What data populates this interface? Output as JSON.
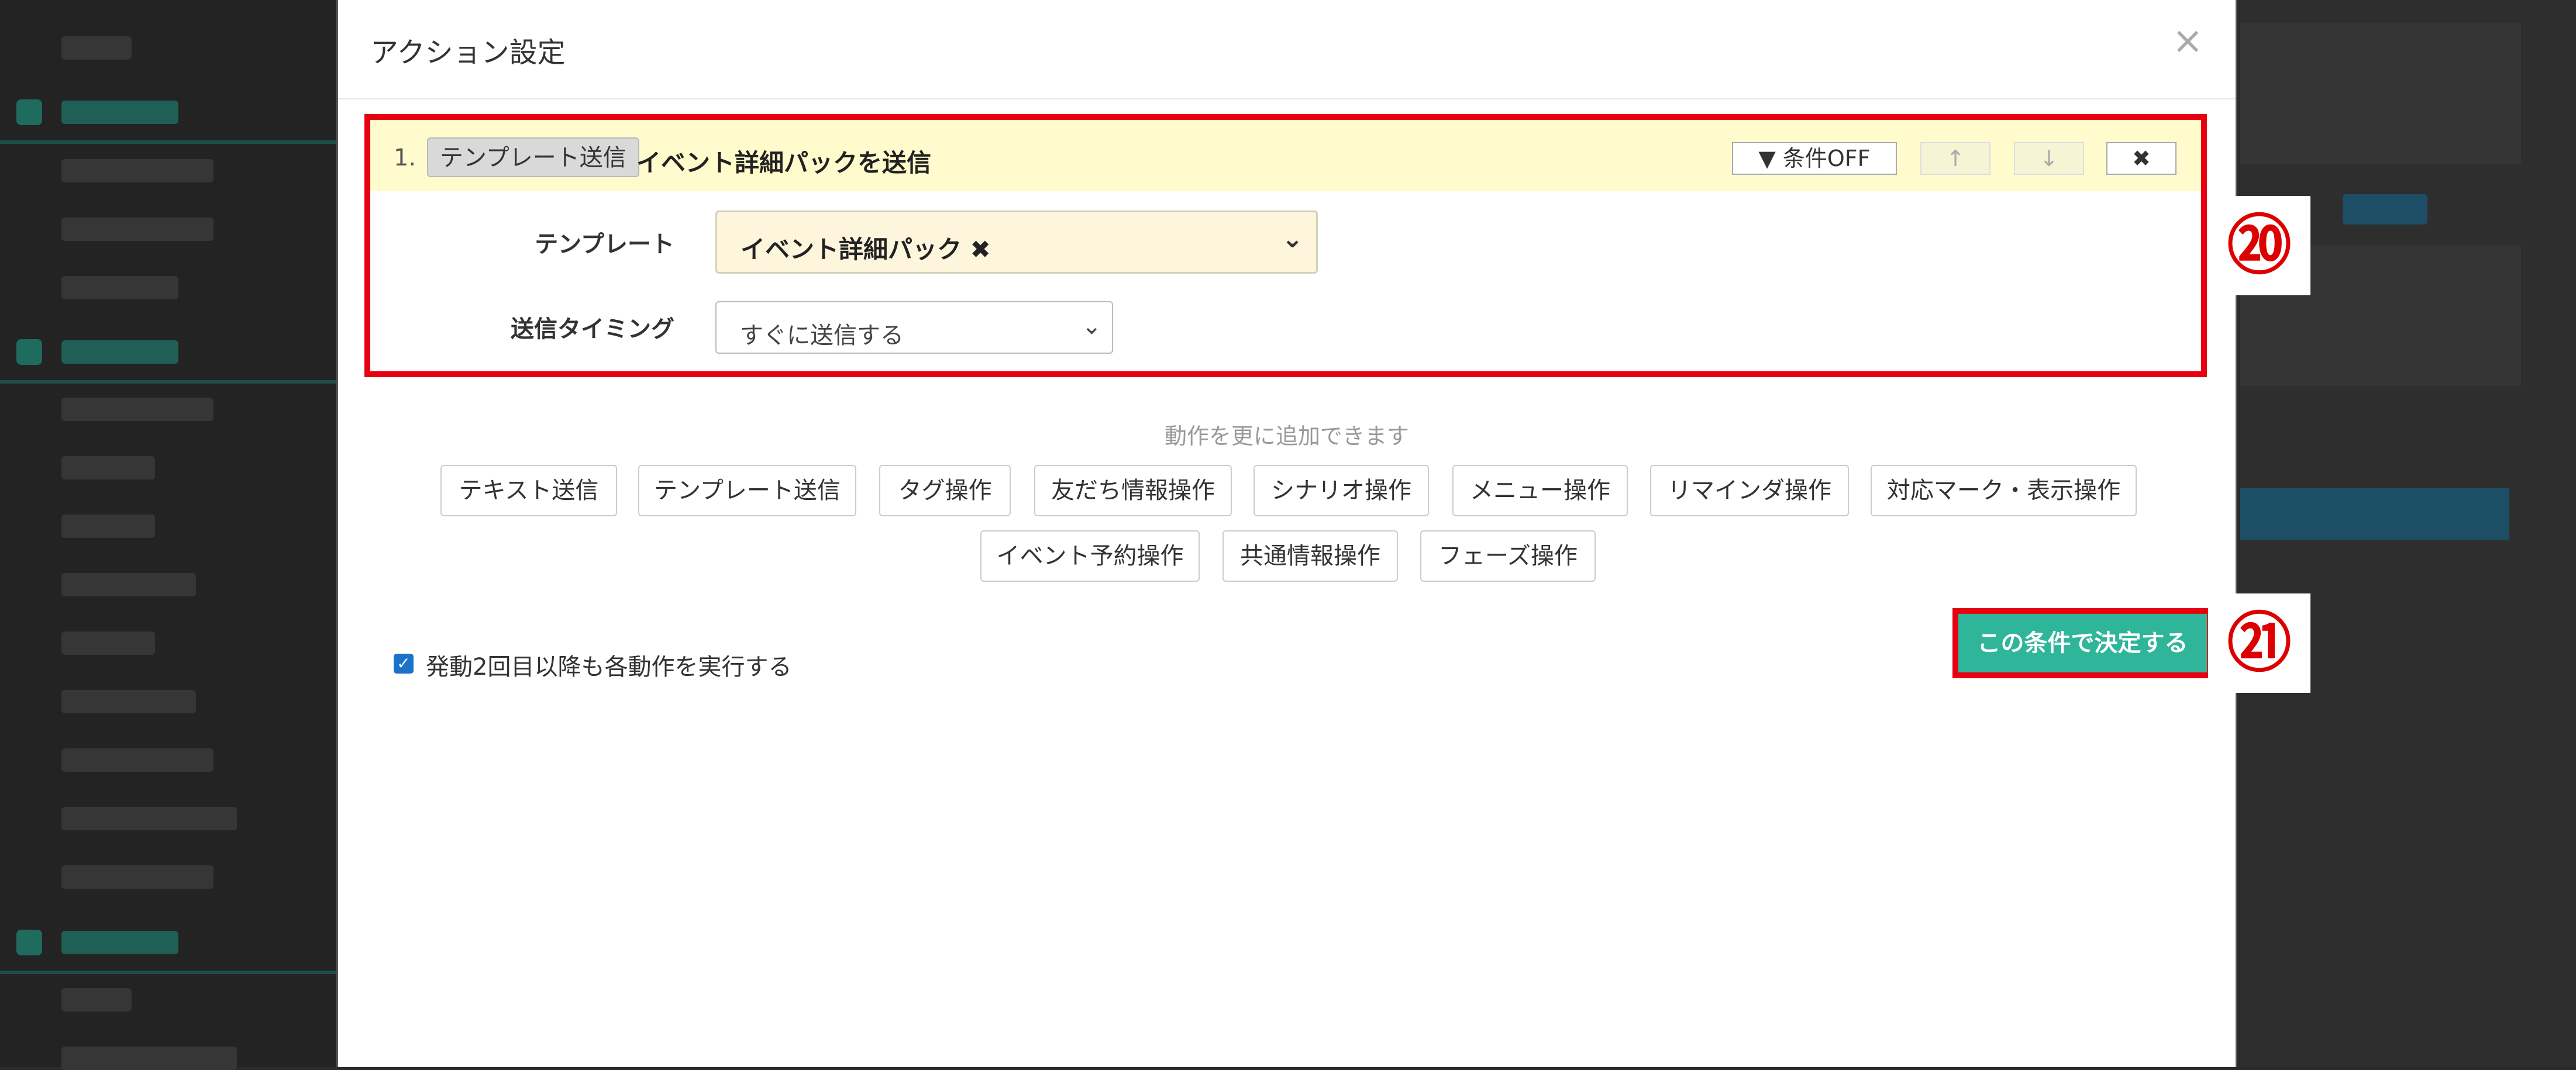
{
  "modal": {
    "title": "アクション設定",
    "close": "×"
  },
  "action": {
    "number": "1.",
    "type_badge": "テンプレート送信",
    "title": "イベント詳細パックを送信",
    "condition_button": "▼ 条件OFF",
    "up_icon": "↑",
    "down_icon": "↓",
    "delete_icon": "✖",
    "template_label": "テンプレート",
    "template_value": "イベント詳細パック ✖",
    "timing_label": "送信タイミング",
    "timing_value": "すぐに送信する"
  },
  "add_hint": "動作を更に追加できます",
  "add_buttons_row1": [
    "テキスト送信",
    "テンプレート送信",
    "タグ操作",
    "友だち情報操作",
    "シナリオ操作",
    "メニュー操作",
    "リマインダ操作",
    "対応マーク・表示操作"
  ],
  "add_buttons_row2": [
    "イベント予約操作",
    "共通情報操作",
    "フェーズ操作"
  ],
  "checkbox_label": "発動2回目以降も各動作を実行する",
  "confirm_button": "この条件で決定する",
  "callouts": [
    "⑳",
    "㉑"
  ],
  "colors": {
    "accent": "#2fb59a",
    "highlight": "#e60012",
    "header_bg": "#fffbcc"
  }
}
